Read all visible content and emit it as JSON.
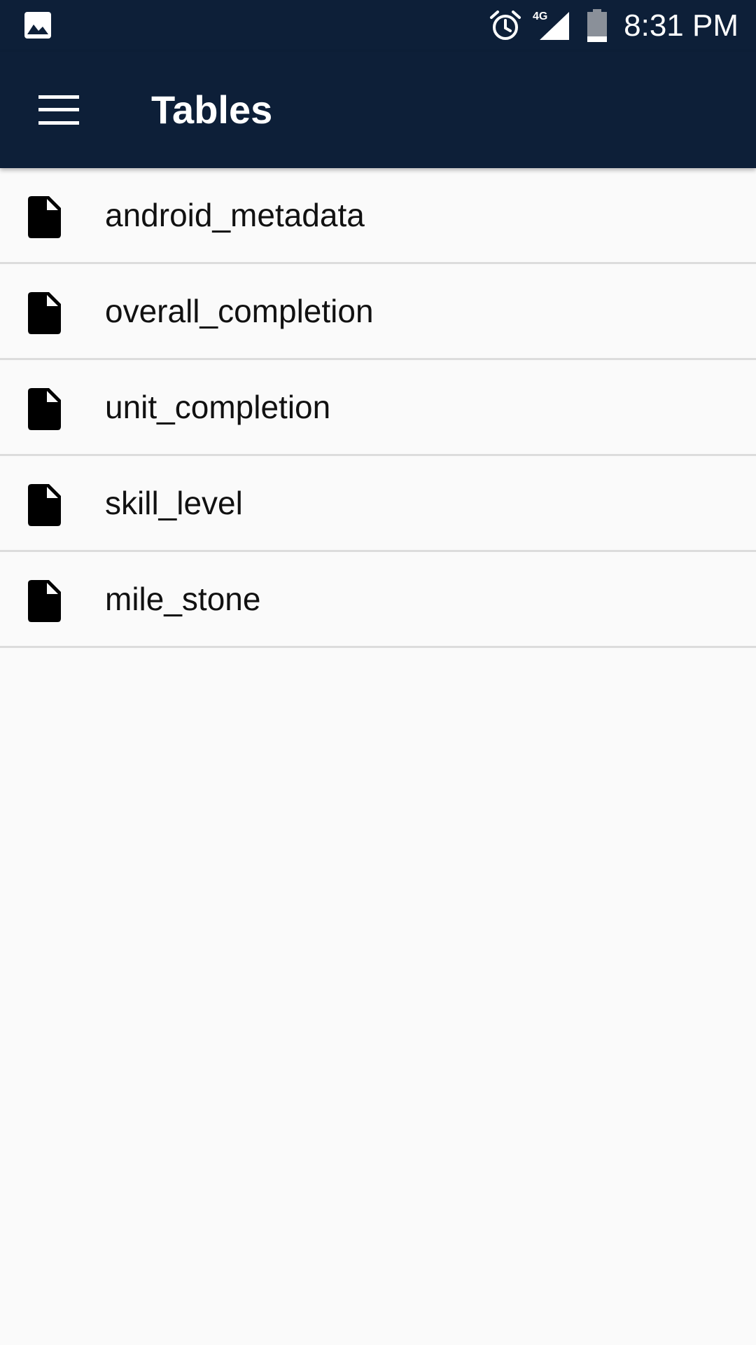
{
  "status_bar": {
    "time": "8:31 PM",
    "network_label": "4G",
    "icons": [
      "gallery-notification-icon",
      "alarm-icon",
      "signal-4g-icon",
      "battery-icon"
    ]
  },
  "app_bar": {
    "menu_icon": "hamburger-menu-icon",
    "title": "Tables"
  },
  "tables": [
    {
      "name": "android_metadata",
      "icon": "file-icon"
    },
    {
      "name": "overall_completion",
      "icon": "file-icon"
    },
    {
      "name": "unit_completion",
      "icon": "file-icon"
    },
    {
      "name": "skill_level",
      "icon": "file-icon"
    },
    {
      "name": "mile_stone",
      "icon": "file-icon"
    }
  ],
  "colors": {
    "app_bar": "#0d1f38",
    "background": "#fafafa",
    "divider": "#dcdcdc",
    "text": "#111111"
  }
}
